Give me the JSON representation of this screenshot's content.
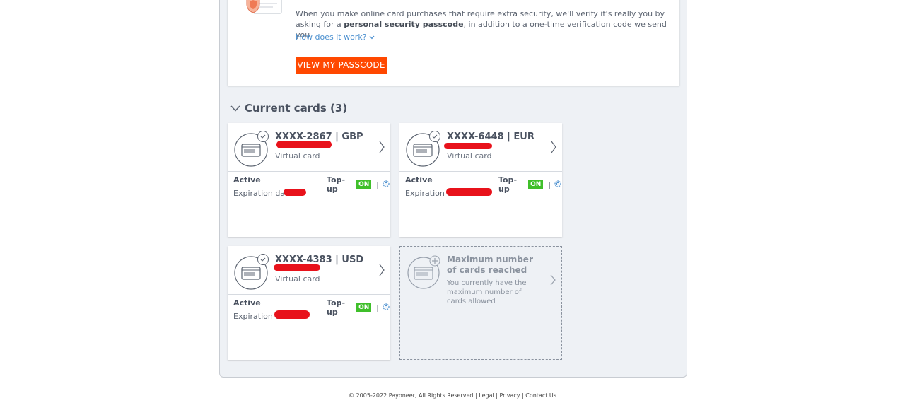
{
  "passcode": {
    "text_before": "When you make online card purchases that require extra security, we'll verify it's really you by asking for a ",
    "text_bold": "personal security passcode",
    "text_after": ", in addition to a one-time verification code we send you.",
    "how_link": "How does it work?",
    "button": "VIEW MY PASSCODE"
  },
  "current_cards": {
    "title": "Current cards (3)",
    "cards": [
      {
        "number": "XXXX-2867 | GBP",
        "type": "Virtual card",
        "status": "Active",
        "topup_label": "Top-up",
        "topup_state": "ON",
        "separator": "|",
        "expiry_label": "Expiration date:"
      },
      {
        "number": "XXXX-6448 | EUR",
        "type": "Virtual card",
        "status": "Active",
        "topup_label": "Top-up",
        "topup_state": "ON",
        "separator": "|",
        "expiry_label": "Expiration da"
      },
      {
        "number": "XXXX-4383 | USD",
        "type": "Virtual card",
        "status": "Active",
        "topup_label": "Top-up",
        "topup_state": "ON",
        "separator": "|",
        "expiry_label": "Expiration da"
      }
    ],
    "max_card": {
      "title": "Maximum number of cards reached",
      "description": "You currently have the maximum number of cards allowed"
    }
  },
  "footer": {
    "copyright": "© 2005-2022 Payoneer, All Rights Reserved",
    "sep": " | ",
    "legal": "Legal",
    "privacy": "Privacy",
    "contact": "Contact Us"
  },
  "colors": {
    "accent": "#ff4800",
    "badge_on": "#3fbf2a",
    "link": "#4a8fcf",
    "redaction": "#e8121b"
  },
  "icons": [
    "shield-card-icon",
    "chevron-down-icon",
    "card-icon",
    "check-icon",
    "chevron-right-icon",
    "gear-icon",
    "plus-card-icon"
  ]
}
